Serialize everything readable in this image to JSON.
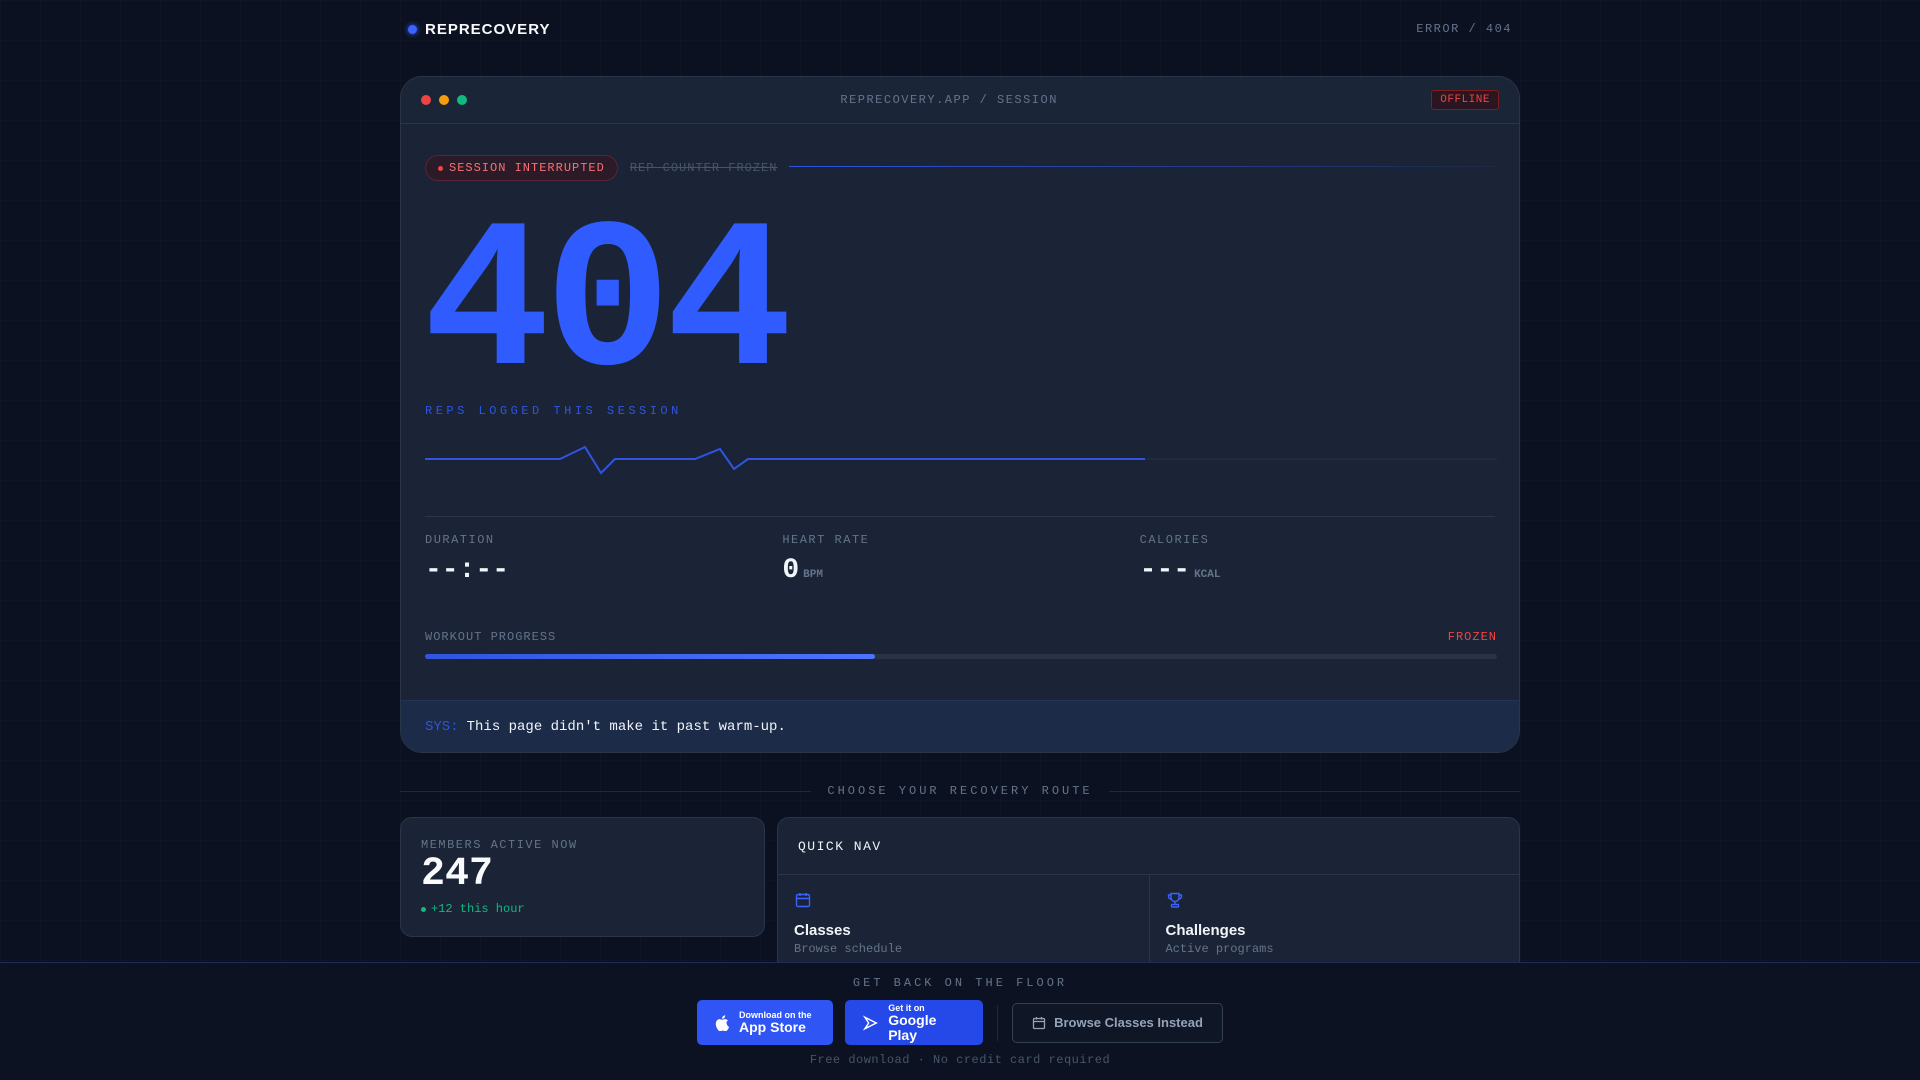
{
  "header": {
    "brand": "REPRECOVERY",
    "error_tag": "ERROR / 404"
  },
  "session_card": {
    "url": "REPRECOVERY.APP / SESSION",
    "status_badge": "OFFLINE",
    "window_dots": [
      "#ef4444",
      "#f59e0b",
      "#10b981"
    ],
    "interrupted_pill": "SESSION INTERRUPTED",
    "frozen_label": "REP COUNTER FROZEN",
    "big_code": "404",
    "reps_label": "REPS LOGGED THIS SESSION",
    "stats": [
      {
        "label": "DURATION",
        "value": "--:--",
        "unit": ""
      },
      {
        "label": "HEART RATE",
        "value": "0",
        "unit": "BPM"
      },
      {
        "label": "CALORIES",
        "value": "---",
        "unit": "KCAL"
      }
    ],
    "progress": {
      "label": "WORKOUT PROGRESS",
      "status": "FROZEN",
      "fraction": 0.42
    },
    "sys_prefix": "SYS:",
    "sys_message": "This page didn't make it past warm-up."
  },
  "route_label": "CHOOSE YOUR RECOVERY ROUTE",
  "members": {
    "label": "MEMBERS ACTIVE NOW",
    "count": "247",
    "delta": "+12 this hour"
  },
  "quick_nav": {
    "title": "QUICK NAV",
    "items": [
      {
        "title": "Classes",
        "subtitle": "Browse schedule",
        "icon": "calendar-icon"
      },
      {
        "title": "Challenges",
        "subtitle": "Active programs",
        "icon": "trophy-icon"
      }
    ]
  },
  "bottom_bar": {
    "label": "GET BACK ON THE FLOOR",
    "app_store_small": "Download on the",
    "app_store_big": "App Store",
    "google_play_small": "Get it on",
    "google_play_big": "Google Play",
    "browse_button": "Browse Classes Instead",
    "note": "Free download · No credit card required"
  },
  "colors": {
    "accent": "#2f5bff",
    "danger": "#ef4444",
    "success": "#10b981",
    "background": "#0b1120",
    "card": "#1a2436"
  }
}
